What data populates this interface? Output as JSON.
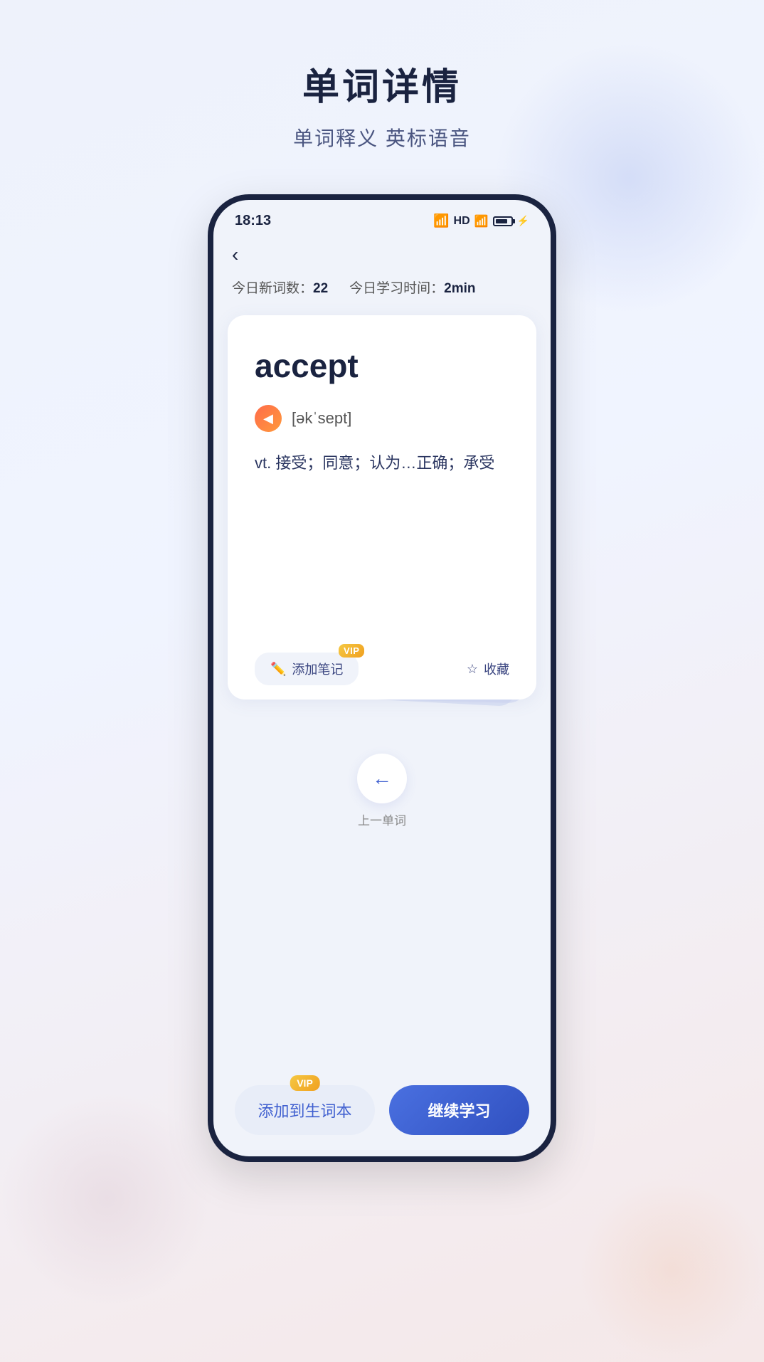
{
  "page": {
    "title": "单词详情",
    "subtitle": "单词释义 英标语音"
  },
  "status_bar": {
    "time": "18:13",
    "hd": "HD",
    "signal": "4G"
  },
  "stats": {
    "new_words_label": "今日新词数：",
    "new_words_count": "22",
    "study_time_label": "今日学习时间：",
    "study_time": "2min"
  },
  "word_card": {
    "word": "accept",
    "phonetic": "[əkˈsept]",
    "definition": "vt. 接受；同意；认为…正确；承受"
  },
  "actions": {
    "add_note": "添加笔记",
    "collect": "收藏",
    "vip_label": "VIP"
  },
  "navigation": {
    "prev_label": "上一单词",
    "arrow": "←"
  },
  "bottom_buttons": {
    "add_vocab": "添加到生词本",
    "continue": "继续学习",
    "vip_label": "VIP"
  }
}
